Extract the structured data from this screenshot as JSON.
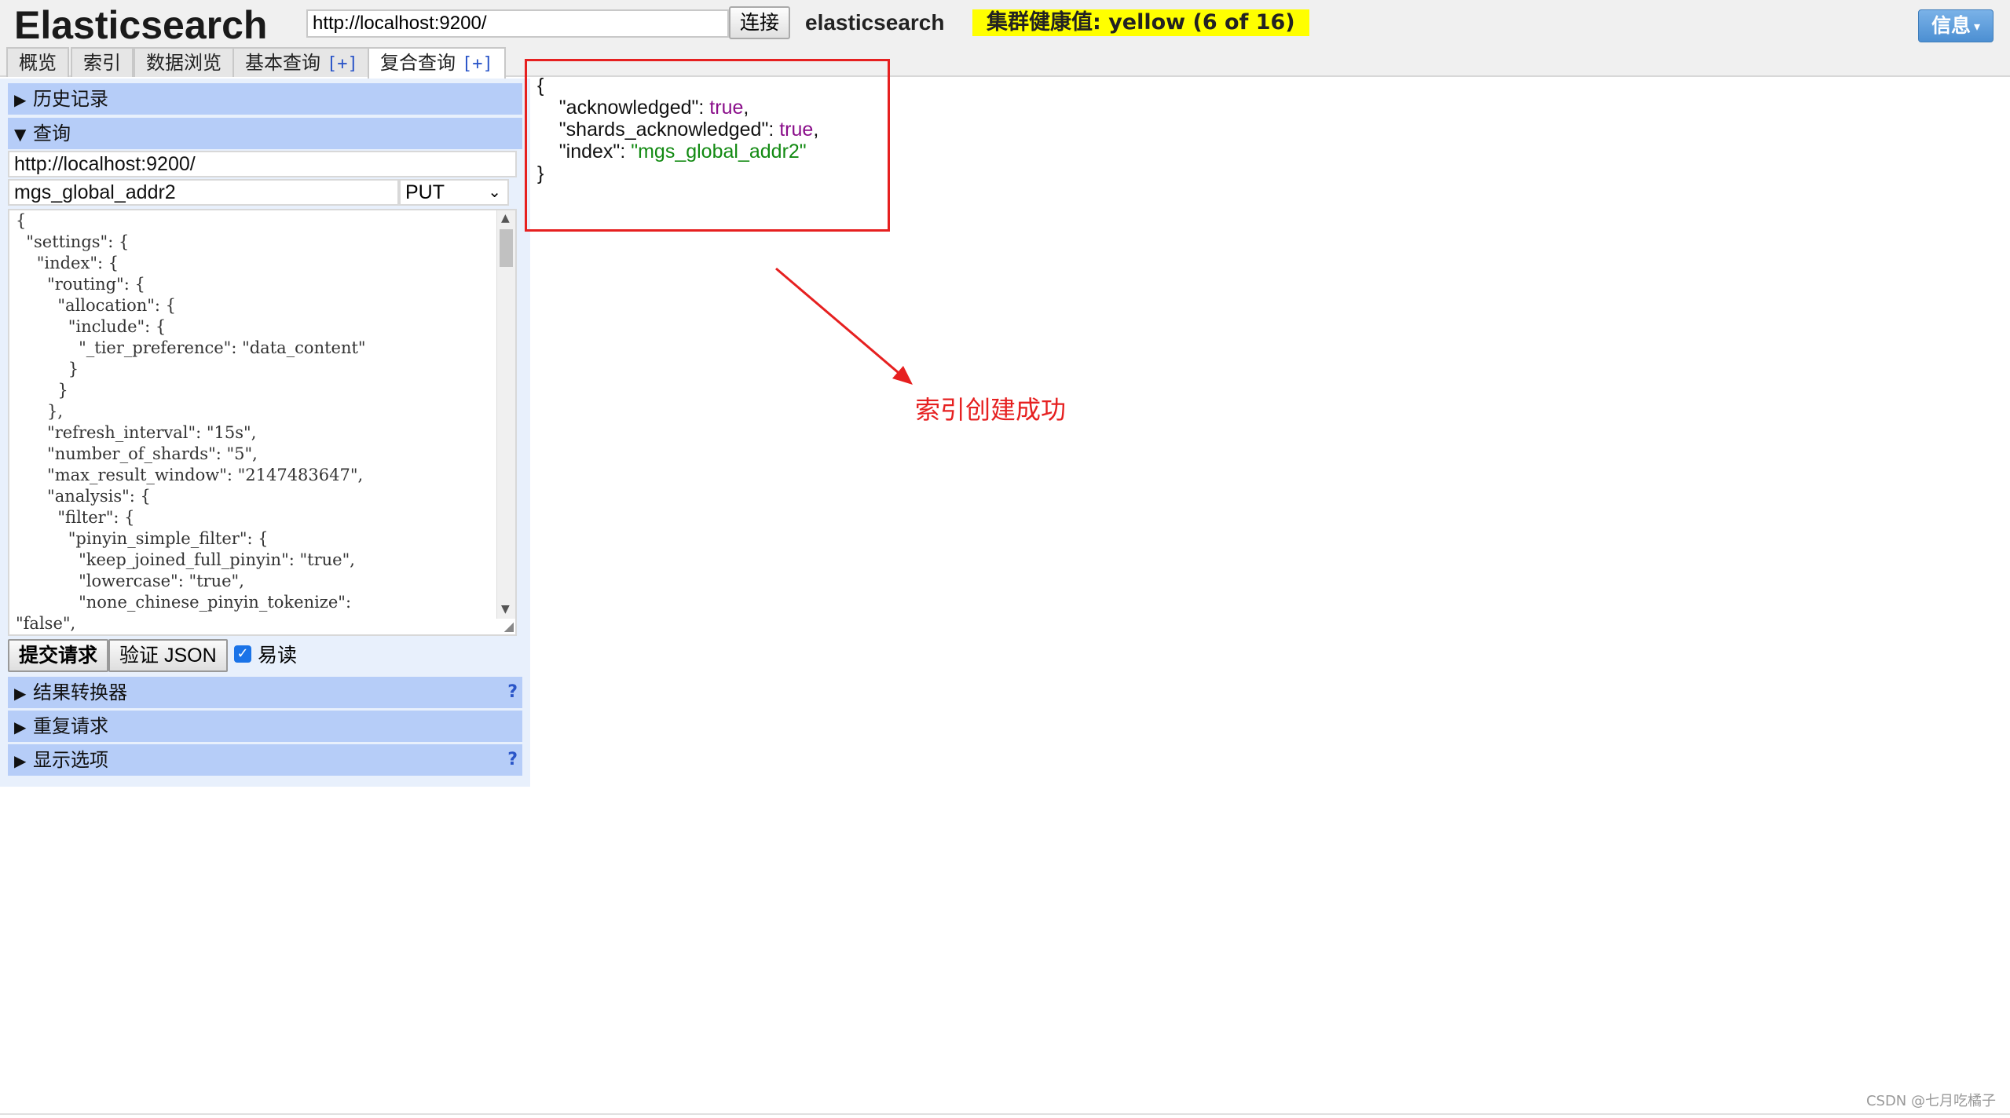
{
  "header": {
    "logo": "Elasticsearch",
    "connect_url": "http://localhost:9200/",
    "connect_button": "连接",
    "cluster_name": "elasticsearch",
    "health": "集群健康值: yellow (6 of 16)",
    "info_button": "信息",
    "health_color": "#ffff00"
  },
  "tabs": [
    {
      "label": "概览"
    },
    {
      "label": "索引"
    },
    {
      "label": "数据浏览"
    },
    {
      "label": "基本查询",
      "plus": "[+]"
    },
    {
      "label": "复合查询",
      "plus": "[+]"
    }
  ],
  "left": {
    "history_label": "历史记录",
    "query_label": "查询",
    "query_url": "http://localhost:9200/",
    "query_path": "mgs_global_addr2",
    "method": "PUT",
    "editor_text": "{\n  \"settings\": {\n    \"index\": {\n      \"routing\": {\n        \"allocation\": {\n          \"include\": {\n            \"_tier_preference\": \"data_content\"\n          }\n        }\n      },\n      \"refresh_interval\": \"15s\",\n      \"number_of_shards\": \"5\",\n      \"max_result_window\": \"2147483647\",\n      \"analysis\": {\n        \"filter\": {\n          \"pinyin_simple_filter\": {\n            \"keep_joined_full_pinyin\": \"true\",\n            \"lowercase\": \"true\",\n            \"none_chinese_pinyin_tokenize\":\n\"false\",",
    "submit_button": "提交请求",
    "validate_button": "验证 JSON",
    "pretty_label": "易读",
    "pretty_checked": true,
    "transformer_label": "结果转换器",
    "repeat_label": "重复请求",
    "display_label": "显示选项",
    "help_mark": "?"
  },
  "result": {
    "open": "{",
    "close": "}",
    "lines": [
      {
        "key": "\"acknowledged\"",
        "value": "true",
        "suffix": ","
      },
      {
        "key": "\"shards_acknowledged\"",
        "value": "true",
        "suffix": ","
      },
      {
        "key": "\"index\"",
        "value": "\"mgs_global_addr2\"",
        "suffix": ""
      }
    ]
  },
  "annotation": {
    "text": "索引创建成功",
    "color": "#e62020"
  },
  "watermark": "CSDN @七月吃橘子"
}
